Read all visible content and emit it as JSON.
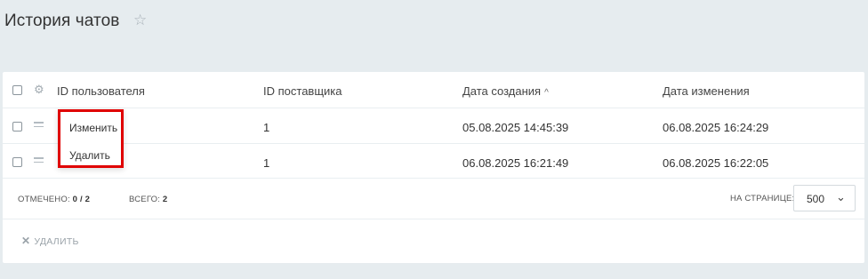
{
  "header": {
    "title": "История чатов",
    "favorite_icon": "star-icon"
  },
  "table": {
    "columns": [
      "ID пользователя",
      "ID поставщика",
      "Дата создания",
      "Дата изменения"
    ],
    "sort_indicator": "^",
    "rows": [
      {
        "user_id": "",
        "provider_id": "1",
        "created": "05.08.2025 14:45:39",
        "updated": "06.08.2025 16:24:29"
      },
      {
        "user_id": "",
        "provider_id": "1",
        "created": "06.08.2025 16:21:49",
        "updated": "06.08.2025 16:22:05"
      }
    ]
  },
  "footer": {
    "selected_label": "ОТМЕЧЕНО:",
    "selected_value": "0 / 2",
    "total_label": "ВСЕГО:",
    "total_value": "2",
    "per_page_label": "НА СТРАНИЦЕ:",
    "per_page_value": "500"
  },
  "actions": {
    "delete_label": "УДАЛИТЬ"
  },
  "context_menu": {
    "items": [
      "Изменить",
      "Удалить"
    ],
    "highlight_color": "#e00000"
  }
}
